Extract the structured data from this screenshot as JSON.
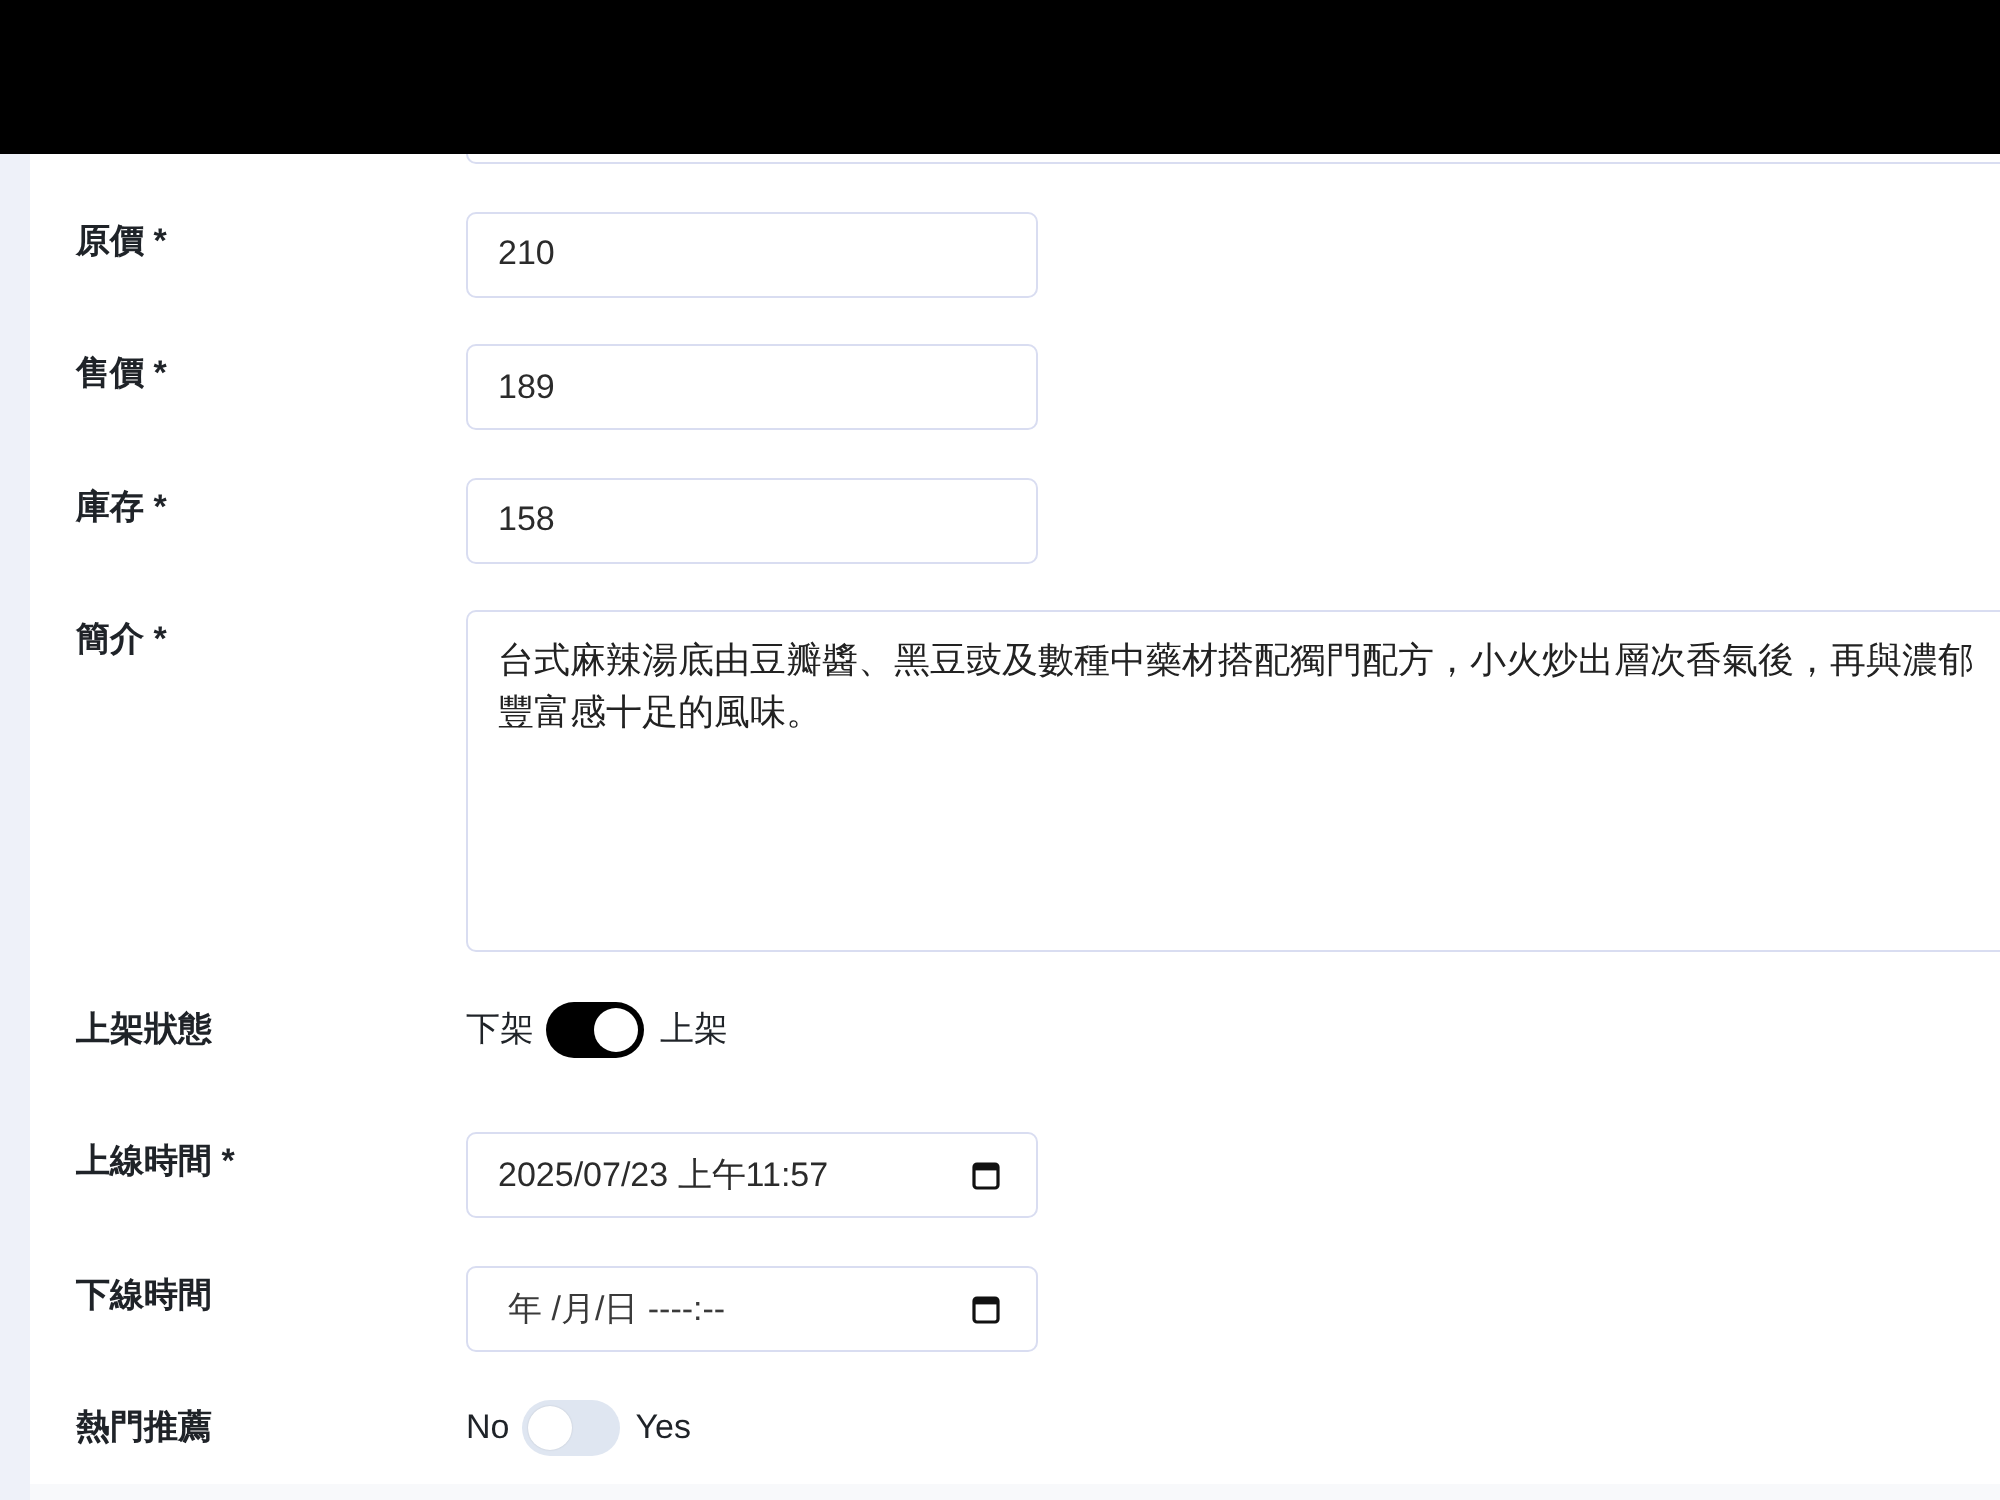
{
  "fields": [
    {
      "kind": "clipped"
    },
    {
      "kind": "text",
      "label": "原價 *",
      "value": "210"
    },
    {
      "kind": "text",
      "label": "售價 *",
      "value": "189"
    },
    {
      "kind": "text",
      "label": "庫存 *",
      "value": "158"
    },
    {
      "kind": "textarea",
      "label": "簡介 *",
      "lines": [
        "台式麻辣湯底由豆瓣醬、黑豆豉及數種中藥材搭配獨門配方，小火炒出層次香氣後，再與濃郁",
        "豐富感十足的風味。"
      ]
    },
    {
      "kind": "switch",
      "label": "上架狀態",
      "off_label": "下架",
      "on_label": "上架",
      "on": true
    },
    {
      "kind": "datetime",
      "label": "上線時間 *",
      "value": "2025/07/23 上午11:57"
    },
    {
      "kind": "datetime",
      "label": "下線時間",
      "placeholder": "年 /月/日 ----:--"
    },
    {
      "kind": "switch",
      "label": "熱門推薦",
      "off_label": "No",
      "on_label": "Yes",
      "on": false
    }
  ]
}
